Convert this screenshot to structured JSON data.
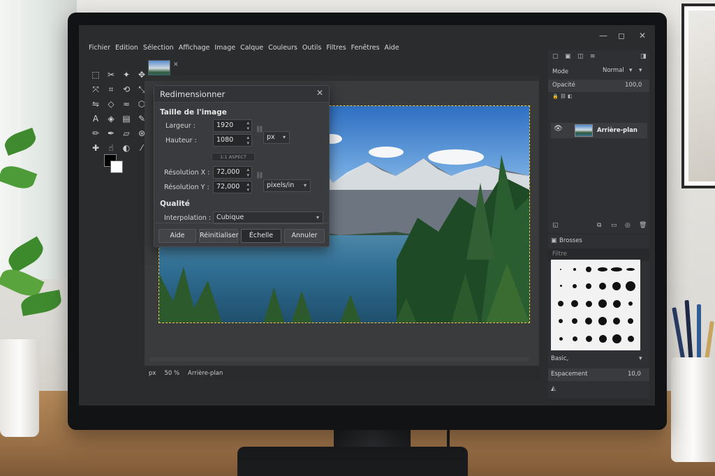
{
  "menu": [
    "Fichier",
    "Edition",
    "Sélection",
    "Affichage",
    "Image",
    "Calque",
    "Couleurs",
    "Outils",
    "Filtres",
    "Fenêtres",
    "Aide"
  ],
  "window_controls": {
    "minimize": "—",
    "maximize": "◻",
    "close": "✕"
  },
  "dialog": {
    "title": "Redimensionner",
    "section_size": "Taille de l'image",
    "width_label": "Largeur :",
    "width_value": "1920",
    "height_label": "Hauteur :",
    "height_value": "1080",
    "unit": "px",
    "aspect_text": "1:1 ASPECT",
    "res_x_label": "Résolution X :",
    "res_x_value": "72,000",
    "res_y_label": "Résolution Y :",
    "res_y_value": "72,000",
    "res_unit": "pixels/in",
    "section_quality": "Qualité",
    "interp_label": "Interpolation :",
    "interp_value": "Cubique",
    "buttons": {
      "help": "Aide",
      "reset": "Réinitialiser",
      "scale": "Échelle",
      "cancel": "Annuler"
    }
  },
  "status": {
    "unit": "px",
    "zoom": "50 %",
    "layer": "Arrière-plan"
  },
  "layers_panel": {
    "mode_label": "Mode",
    "mode_value": "Normal",
    "opacity_label": "Opacité",
    "opacity_value": "100,0",
    "layer_name": "Arrière-plan"
  },
  "brushes_panel": {
    "tab_label": "Brosses",
    "filter_placeholder": "Filtre",
    "brush_name": "Basic,",
    "spacing_label": "Espacement",
    "spacing_value": "10,0"
  },
  "colors": {
    "accent": "#e4d44a",
    "panel": "#2f3033",
    "dialog": "#3a3b3e"
  }
}
